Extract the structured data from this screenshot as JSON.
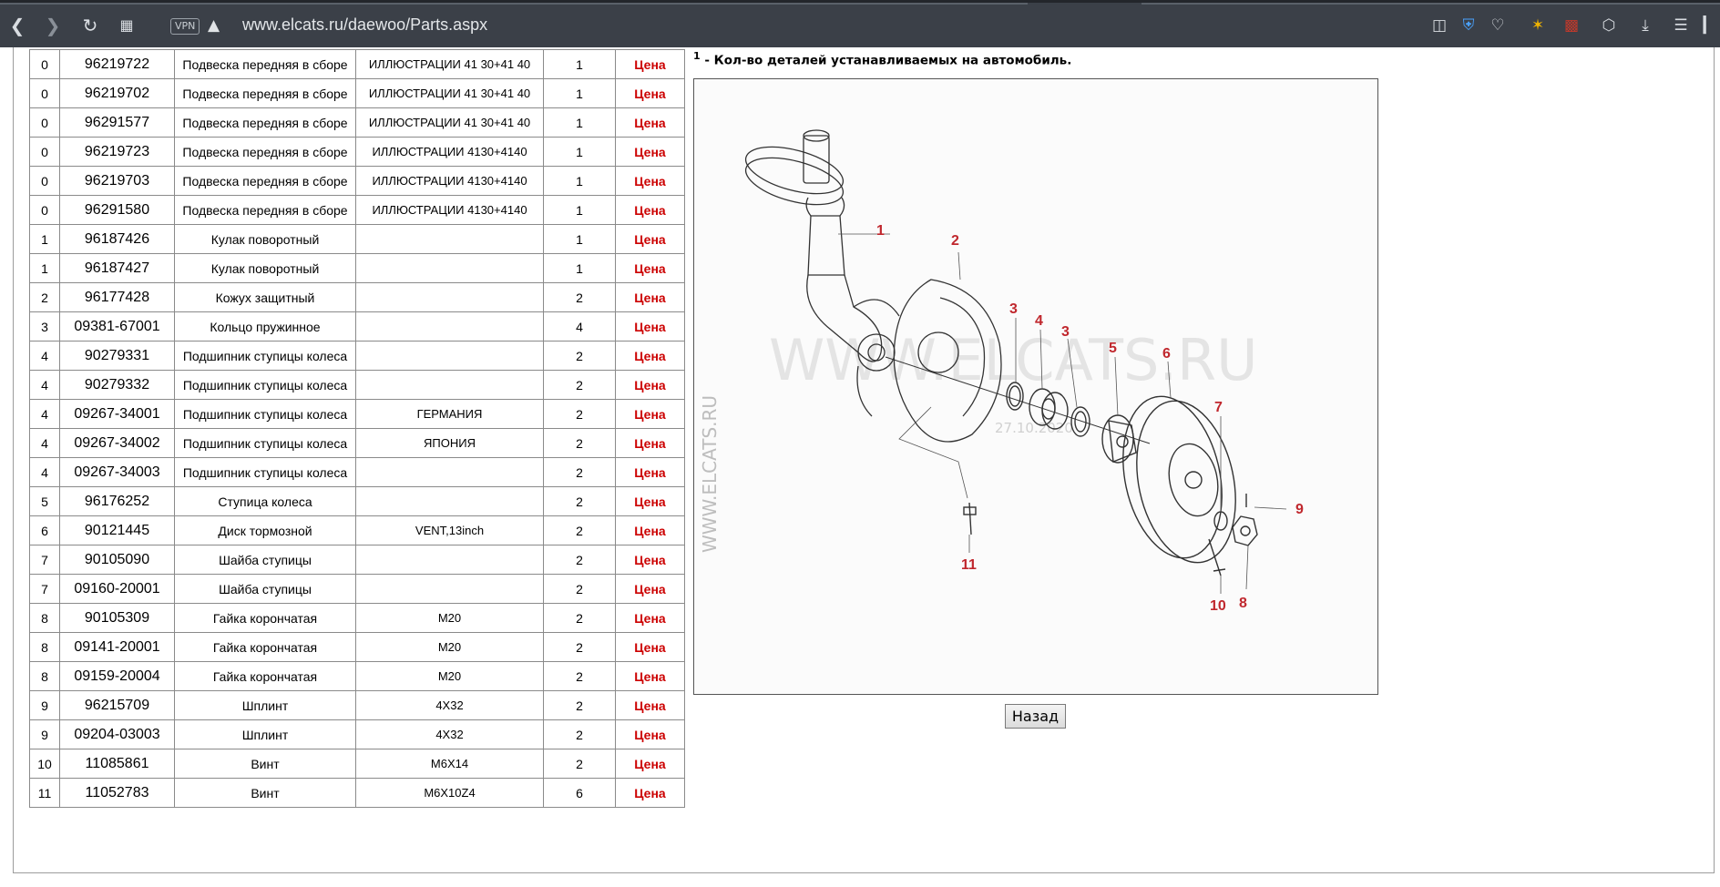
{
  "browser": {
    "vpn_label": "VPN",
    "url": "www.elcats.ru/daewoo/Parts.aspx"
  },
  "parts": [
    {
      "pos": "0",
      "number": "96219722",
      "name": "Подвеска передняя в сборе",
      "note": "ИЛЛЮСТРАЦИИ 41 30+41 40",
      "qty": "1",
      "price": "Цена"
    },
    {
      "pos": "0",
      "number": "96219702",
      "name": "Подвеска передняя в сборе",
      "note": "ИЛЛЮСТРАЦИИ 41 30+41 40",
      "qty": "1",
      "price": "Цена"
    },
    {
      "pos": "0",
      "number": "96291577",
      "name": "Подвеска передняя в сборе",
      "note": "ИЛЛЮСТРАЦИИ 41 30+41 40",
      "qty": "1",
      "price": "Цена"
    },
    {
      "pos": "0",
      "number": "96219723",
      "name": "Подвеска передняя в сборе",
      "note": "ИЛЛЮСТРАЦИИ 4130+4140",
      "qty": "1",
      "price": "Цена"
    },
    {
      "pos": "0",
      "number": "96219703",
      "name": "Подвеска передняя в сборе",
      "note": "ИЛЛЮСТРАЦИИ 4130+4140",
      "qty": "1",
      "price": "Цена"
    },
    {
      "pos": "0",
      "number": "96291580",
      "name": "Подвеска передняя в сборе",
      "note": "ИЛЛЮСТРАЦИИ 4130+4140",
      "qty": "1",
      "price": "Цена"
    },
    {
      "pos": "1",
      "number": "96187426",
      "name": "Кулак поворотный",
      "note": "",
      "qty": "1",
      "price": "Цена"
    },
    {
      "pos": "1",
      "number": "96187427",
      "name": "Кулак поворотный",
      "note": "",
      "qty": "1",
      "price": "Цена"
    },
    {
      "pos": "2",
      "number": "96177428",
      "name": "Кожух защитный",
      "note": "",
      "qty": "2",
      "price": "Цена"
    },
    {
      "pos": "3",
      "number": "09381-67001",
      "name": "Кольцо пружинное",
      "note": "",
      "qty": "4",
      "price": "Цена"
    },
    {
      "pos": "4",
      "number": "90279331",
      "name": "Подшипник ступицы колеса",
      "note": "",
      "qty": "2",
      "price": "Цена"
    },
    {
      "pos": "4",
      "number": "90279332",
      "name": "Подшипник ступицы колеса",
      "note": "",
      "qty": "2",
      "price": "Цена"
    },
    {
      "pos": "4",
      "number": "09267-34001",
      "name": "Подшипник ступицы колеса",
      "note": "ГЕРМАНИЯ",
      "qty": "2",
      "price": "Цена"
    },
    {
      "pos": "4",
      "number": "09267-34002",
      "name": "Подшипник ступицы колеса",
      "note": "ЯПОНИЯ",
      "qty": "2",
      "price": "Цена"
    },
    {
      "pos": "4",
      "number": "09267-34003",
      "name": "Подшипник ступицы колеса",
      "note": "",
      "qty": "2",
      "price": "Цена"
    },
    {
      "pos": "5",
      "number": "96176252",
      "name": "Ступица колеса",
      "note": "",
      "qty": "2",
      "price": "Цена"
    },
    {
      "pos": "6",
      "number": "90121445",
      "name": "Диск тормозной",
      "note": "VENT,13inch",
      "qty": "2",
      "price": "Цена"
    },
    {
      "pos": "7",
      "number": "90105090",
      "name": "Шайба ступицы",
      "note": "",
      "qty": "2",
      "price": "Цена"
    },
    {
      "pos": "7",
      "number": "09160-20001",
      "name": "Шайба ступицы",
      "note": "",
      "qty": "2",
      "price": "Цена"
    },
    {
      "pos": "8",
      "number": "90105309",
      "name": "Гайка корончатая",
      "note": "M20",
      "qty": "2",
      "price": "Цена"
    },
    {
      "pos": "8",
      "number": "09141-20001",
      "name": "Гайка корончатая",
      "note": "M20",
      "qty": "2",
      "price": "Цена"
    },
    {
      "pos": "8",
      "number": "09159-20004",
      "name": "Гайка корончатая",
      "note": "M20",
      "qty": "2",
      "price": "Цена"
    },
    {
      "pos": "9",
      "number": "96215709",
      "name": "Шплинт",
      "note": "4X32",
      "qty": "2",
      "price": "Цена"
    },
    {
      "pos": "9",
      "number": "09204-03003",
      "name": "Шплинт",
      "note": "4X32",
      "qty": "2",
      "price": "Цена"
    },
    {
      "pos": "10",
      "number": "11085861",
      "name": "Винт",
      "note": "M6X14",
      "qty": "2",
      "price": "Цена"
    },
    {
      "pos": "11",
      "number": "11052783",
      "name": "Винт",
      "note": "M6X10Z4",
      "qty": "6",
      "price": "Цена"
    }
  ],
  "qty_note": {
    "superscript": "1",
    "text": " - Кол-во деталей устанавливаемых на автомобиль."
  },
  "diagram": {
    "watermark_main": "WWW.ELCATS.RU",
    "watermark_side": "WWW.ELCATS.RU",
    "watermark_date": "27.10.2020",
    "callouts": [
      "1",
      "2",
      "3",
      "4",
      "3",
      "5",
      "6",
      "7",
      "9",
      "11",
      "10",
      "8"
    ]
  },
  "back_label": "Назад"
}
